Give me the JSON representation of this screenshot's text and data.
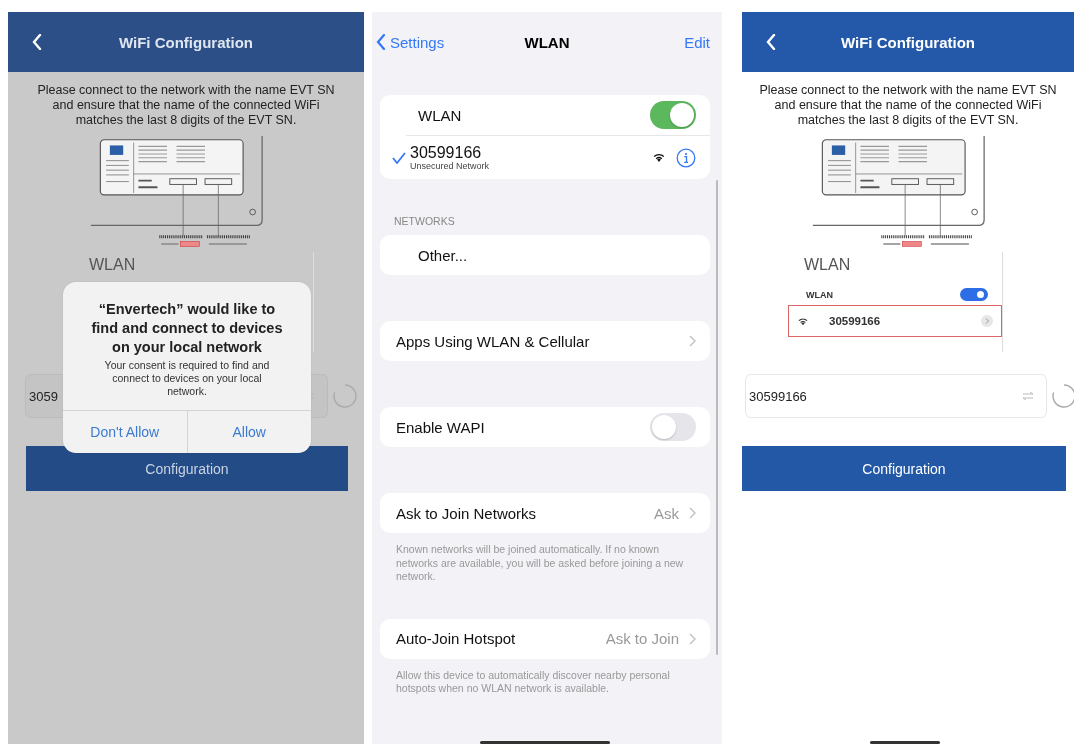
{
  "app_screens": [
    {
      "kind": "dimmed",
      "title": "WiFi Configuration",
      "instruction": "Please connect to the network with the name EVT SN and ensure that the name of the connected WiFi matches the last 8 digits of the EVT SN.",
      "inset": {
        "heading": "WLAN"
      },
      "ssid_field": {
        "value": "3059"
      },
      "button": "Configuration",
      "dialog": {
        "title": "“Envertech” would like to find and connect to devices on your local network",
        "message": "Your consent is required to find and connect to devices on your local network.",
        "buttons": [
          "Don't Allow",
          "Allow"
        ]
      }
    },
    {
      "kind": "normal",
      "title": "WiFi Configuration",
      "instruction": "Please connect to the network with the name EVT SN and ensure that the name of the connected WiFi matches the last 8 digits of the EVT SN.",
      "inset": {
        "heading": "WLAN",
        "toggle": {
          "label": "WLAN",
          "on": true
        },
        "network": {
          "name": "30599166",
          "highlighted": true
        }
      },
      "ssid_field": {
        "value": "30599166"
      },
      "button": "Configuration"
    }
  ],
  "settings": {
    "nav": {
      "back": "Settings",
      "title": "WLAN",
      "action": "Edit"
    },
    "groups": [
      {
        "rows": [
          {
            "kind": "toggle",
            "label": "WLAN",
            "on": true,
            "indent": true
          },
          {
            "kind": "network",
            "label": "30599166",
            "subtitle": "Unsecured Network",
            "selected": true
          }
        ]
      },
      {
        "header": "NETWORKS",
        "rows": [
          {
            "kind": "plain",
            "label": "Other...",
            "indent": true
          }
        ]
      },
      {
        "rows": [
          {
            "kind": "link",
            "label": "Apps Using WLAN & Cellular"
          }
        ]
      },
      {
        "rows": [
          {
            "kind": "toggle",
            "label": "Enable WAPI",
            "on": false
          }
        ]
      },
      {
        "rows": [
          {
            "kind": "link",
            "label": "Ask to Join Networks",
            "value": "Ask"
          }
        ],
        "footer": "Known networks will be joined automatically. If no known networks are available, you will be asked before joining a new network."
      },
      {
        "rows": [
          {
            "kind": "link",
            "label": "Auto-Join Hotspot",
            "value": "Ask to Join"
          }
        ],
        "footer": "Allow this device to automatically discover nearby personal hotspots when no WLAN network is available."
      }
    ]
  }
}
